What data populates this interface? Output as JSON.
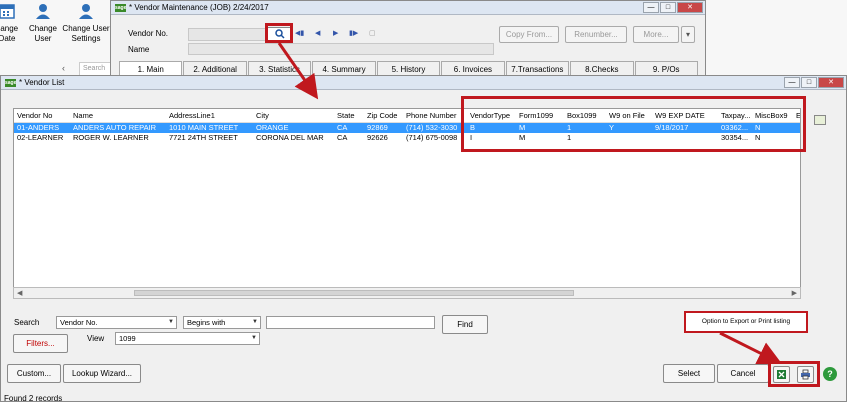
{
  "background_app": {
    "tools": [
      {
        "label": "hange\nDate",
        "icon": "calendar-icon"
      },
      {
        "label": "Change\nUser",
        "icon": "user-icon"
      },
      {
        "label": "Change User\nSettings",
        "icon": "user-settings-icon"
      }
    ],
    "search_placeholder": "Search"
  },
  "maintenance": {
    "title": "* Vendor Maintenance (JOB) 2/24/2017",
    "vendor_no_label": "Vendor No.",
    "name_label": "Name",
    "buttons": {
      "copy_from": "Copy From...",
      "renumber": "Renumber...",
      "more": "More..."
    },
    "tabs": [
      "1. Main",
      "2. Additional",
      "3. Statistics",
      "4. Summary",
      "5. History",
      "6. Invoices",
      "7.Transactions",
      "8.Checks",
      "9. P/Os"
    ]
  },
  "vendor_list": {
    "title": "* Vendor List",
    "columns": [
      "Vendor No",
      "Name",
      "AddressLine1",
      "City",
      "State",
      "Zip Code",
      "Phone Number",
      "VendorType",
      "Form1099",
      "Box1099",
      "W9 on File",
      "W9 EXP DATE",
      "Taxpay...",
      "MiscBox9",
      "E"
    ],
    "rows": [
      [
        "01-ANDERS",
        "ANDERS AUTO REPAIR",
        "1010 MAIN STREET",
        "ORANGE",
        "CA",
        "92869",
        "(714) 532-3030",
        "B",
        "M",
        "1",
        "Y",
        "9/18/2017",
        "03362...",
        "N",
        ""
      ],
      [
        "02-LEARNER",
        "ROGER W. LEARNER",
        "7721 24TH STREET",
        "CORONA DEL MAR",
        "CA",
        "92626",
        "(714) 675-0098",
        "I",
        "M",
        "1",
        "",
        "",
        "30354...",
        "N",
        ""
      ]
    ],
    "selected_row_index": 0,
    "search_label": "Search",
    "search_field_value": "Vendor No.",
    "search_mode_value": "Begins with",
    "search_text_value": "",
    "find_label": "Find",
    "filters_label": "Filters...",
    "view_label": "View",
    "view_value": "1099",
    "custom_label": "Custom...",
    "lookup_wizard_label": "Lookup Wizard...",
    "select_label": "Select",
    "cancel_label": "Cancel",
    "status_text": "Found 2 records"
  },
  "annotation": {
    "callout_text": "Option to Export or Print listing",
    "accent_color": "#c0181e"
  },
  "colors": {
    "selection": "#3399ff",
    "filters_text": "#c00000"
  }
}
